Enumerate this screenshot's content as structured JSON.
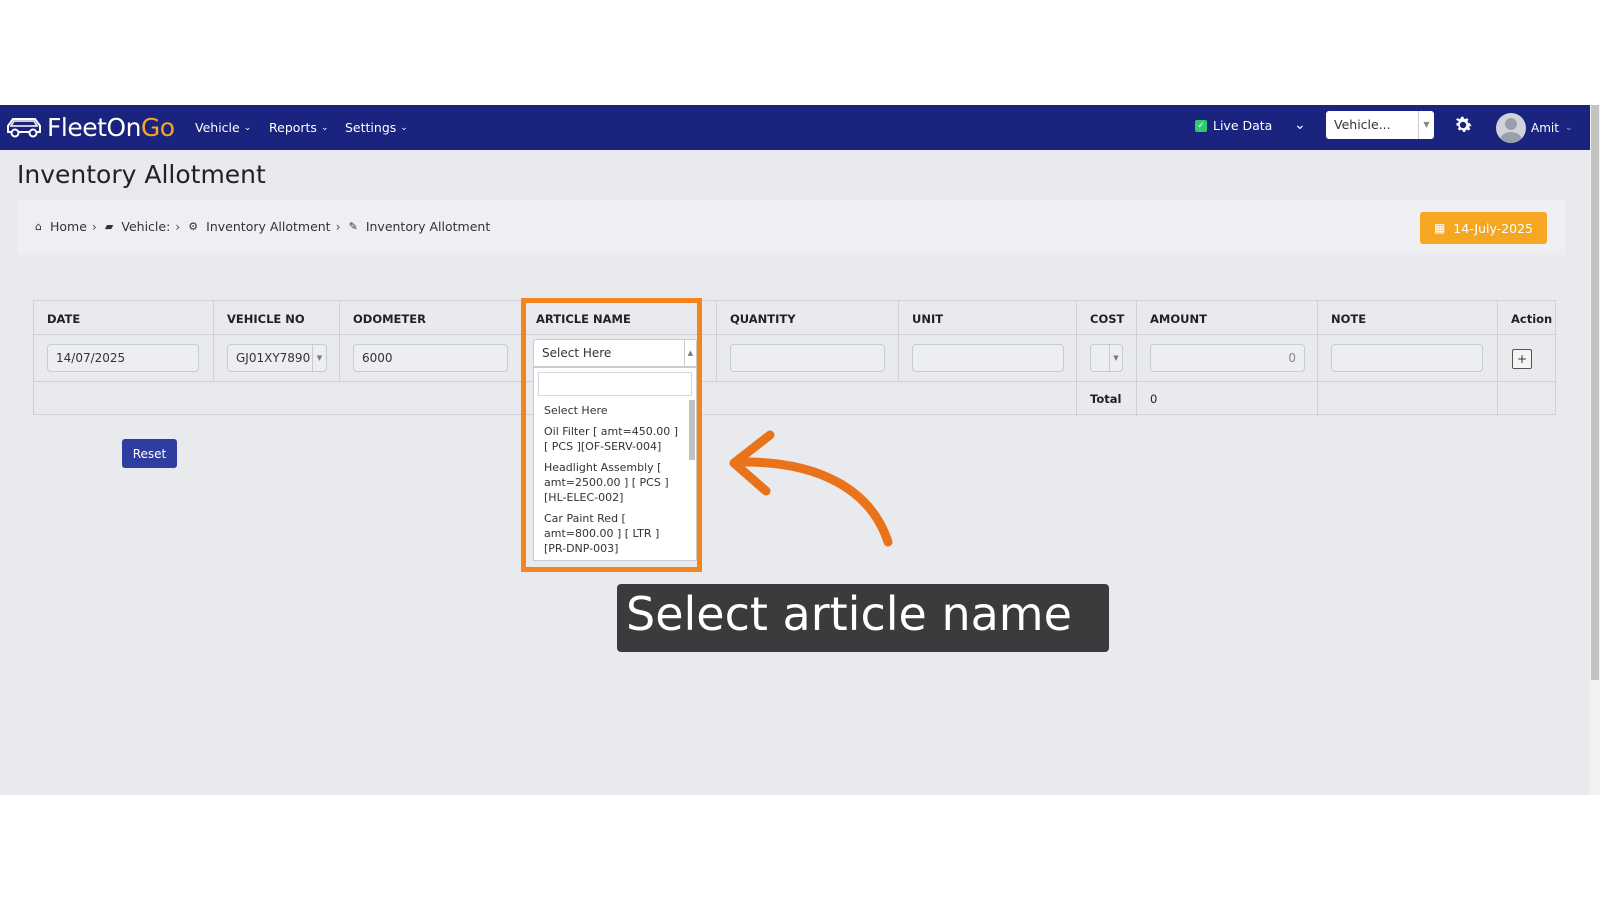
{
  "app": {
    "brand_part1": "FleetOn",
    "brand_part2": "Go"
  },
  "nav": {
    "vehicle": "Vehicle",
    "reports": "Reports",
    "settings": "Settings",
    "live_data": "Live Data",
    "live_data_checked": true,
    "vehicle_select": "Vehicle...",
    "user": "Amit"
  },
  "page": {
    "title": "Inventory Allotment",
    "date_button": "14-July-2025"
  },
  "breadcrumb": [
    {
      "label": "Home",
      "icon": "home-icon"
    },
    {
      "label": "Vehicle:",
      "icon": "truck-icon"
    },
    {
      "label": "Inventory Allotment",
      "icon": "gears-icon"
    },
    {
      "label": "Inventory Allotment",
      "icon": "edit-icon"
    }
  ],
  "table": {
    "headers": [
      "DATE",
      "VEHICLE NO",
      "ODOMETER",
      "ARTICLE NAME",
      "QUANTITY",
      "UNIT",
      "COST",
      "AMOUNT",
      "NOTE",
      "Action"
    ],
    "row": {
      "date": "14/07/2025",
      "vehicle_no": "GJ01XY7890",
      "odometer": "6000",
      "article_name": "Select Here",
      "quantity": "",
      "unit": "",
      "cost": "",
      "amount": "0",
      "note": "",
      "action": "+"
    },
    "total_label": "Total",
    "total_value": "0"
  },
  "dropdown": {
    "options": [
      "Select Here",
      "Oil Filter [ amt=450.00 ] [ PCS ][OF-SERV-004]",
      "Headlight Assembly [ amt=2500.00 ] [ PCS ] [HL-ELEC-002]",
      "Car Paint Red [ amt=800.00 ] [ LTR ][PR-DNP-003]"
    ]
  },
  "buttons": {
    "reset": "Reset"
  },
  "annotation": {
    "caption": "Select article name",
    "highlight_color": "#f5841f"
  },
  "colors": {
    "navbar": "#1a237e",
    "accent": "#f5a623",
    "primary_button": "#2f3da0"
  }
}
